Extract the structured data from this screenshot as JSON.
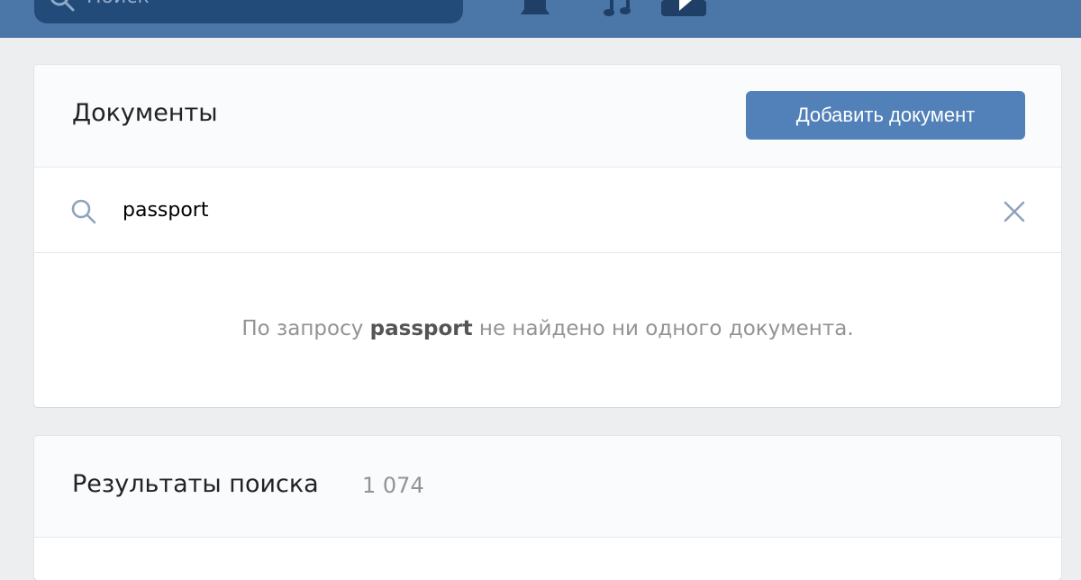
{
  "topbar": {
    "search_placeholder": "Поиск",
    "icons": [
      "search-icon",
      "bell-icon",
      "music-icon",
      "video-icon"
    ],
    "background": "#4a76a8"
  },
  "documents": {
    "title": "Документы",
    "add_button": "Добавить документ",
    "search_value": "passport",
    "empty_prefix": "По запросу ",
    "empty_query": "passport",
    "empty_suffix": " не найдено ни одного документа."
  },
  "results": {
    "title": "Результаты поиска",
    "count": "1 074"
  },
  "colors": {
    "accent": "#5181b8",
    "page_bg": "#edeef0"
  }
}
